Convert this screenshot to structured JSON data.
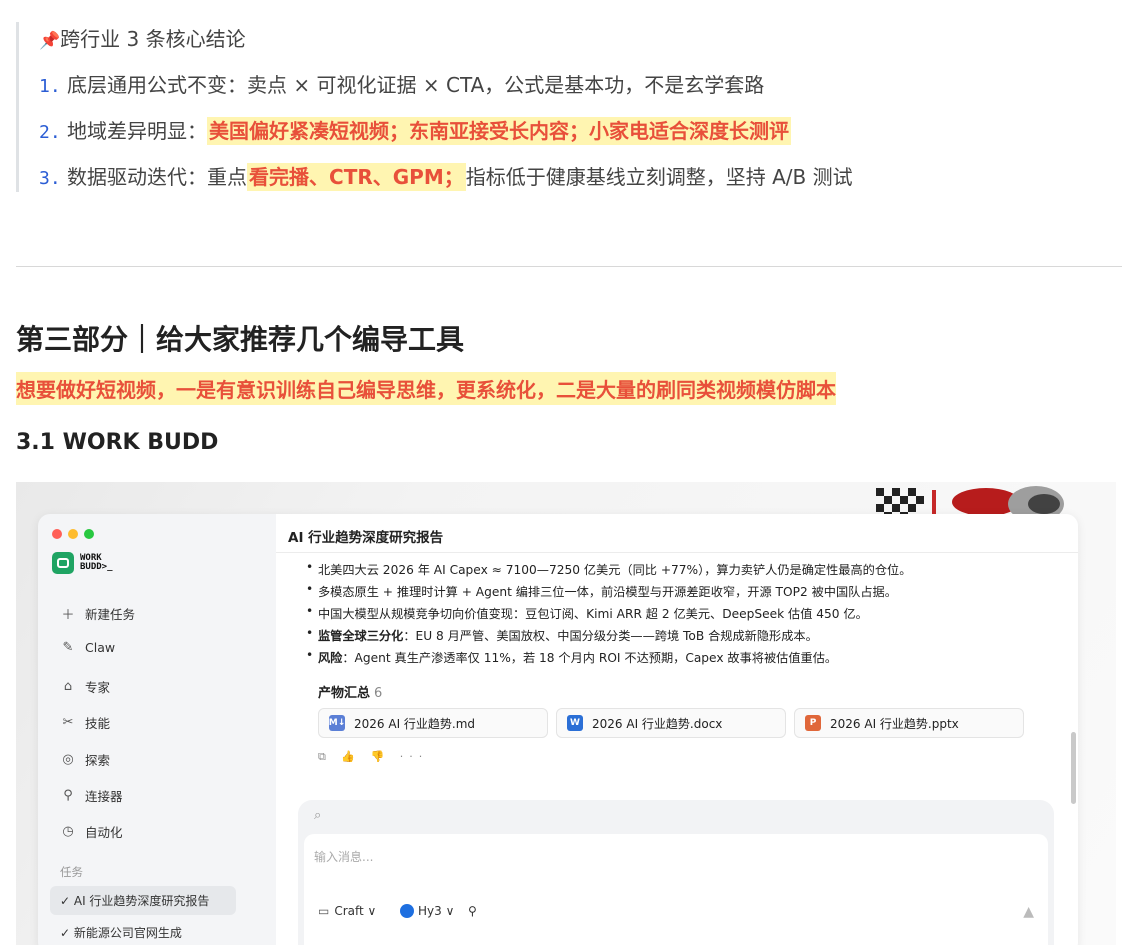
{
  "article": {
    "quote": {
      "pin_icon": "pushpin-icon",
      "title": "跨行业 3 条核心结论",
      "items": [
        {
          "num": "1.",
          "text": "底层通用公式不变：卖点 × 可视化证据 × CTA，公式是基本功，不是玄学套路"
        },
        {
          "num": "2.",
          "prefix": "地域差异明显：",
          "highlight": "美国偏好紧凑短视频；东南亚接受长内容；小家电适合深度长测评"
        },
        {
          "num": "3.",
          "prefix": "数据驱动迭代：重点",
          "highlight": "看完播、CTR、GPM；",
          "suffix": "指标低于健康基线立刻调整，坚持 A/B 测试"
        }
      ]
    },
    "section_title": "第三部分｜给大家推荐几个编导工具",
    "lead": "想要做好短视频，一是有意识训练自己编导思维，更系统化，二是大量的刷同类视频模仿脚本",
    "subheading": "3.1 WORK BUDD"
  },
  "app": {
    "logo_text_1": "WORK",
    "logo_text_2": "BUDD>_",
    "sidebar": {
      "items": [
        {
          "icon": "plus-icon",
          "glyph": "＋",
          "label": "新建任务"
        },
        {
          "icon": "claw-icon",
          "glyph": "✎",
          "label": "Claw"
        },
        {
          "icon": "graduation-cap-icon",
          "glyph": "⌂",
          "label": "专家"
        },
        {
          "icon": "tools-icon",
          "glyph": "✂",
          "label": "技能"
        },
        {
          "icon": "compass-icon",
          "glyph": "◎",
          "label": "探索"
        },
        {
          "icon": "connector-icon",
          "glyph": "⚲",
          "label": "连接器"
        },
        {
          "icon": "clock-icon",
          "glyph": "◷",
          "label": "自动化"
        }
      ],
      "group_label": "任务",
      "tasks": [
        {
          "label": "✓ AI 行业趋势深度研究报告",
          "active": true
        },
        {
          "label": "✓ 新能源公司官网生成",
          "active": false
        }
      ]
    },
    "main": {
      "title": "AI 行业趋势深度研究报告",
      "bullets": [
        {
          "bold": "",
          "text": "北美四大云 2026 年 AI Capex ≈ 7100—7250 亿美元（同比 +77%），算力卖铲人仍是确定性最高的仓位。"
        },
        {
          "bold": "",
          "text": "多模态原生 + 推理时计算 + Agent 编排三位一体，前沿模型与开源差距收窄，开源 TOP2 被中国队占据。"
        },
        {
          "bold": "",
          "text": "中国大模型从规模竞争切向价值变现：豆包订阅、Kimi ARR 超 2 亿美元、DeepSeek 估值 450 亿。"
        },
        {
          "bold": "监管全球三分化",
          "text": "：EU 8 月严管、美国放权、中国分级分类——跨境 ToB 合规成新隐形成本。"
        },
        {
          "bold": "风险",
          "text": "：Agent 真生产渗透率仅 11%，若 18 个月内 ROI 不达预期，Capex 故事将被估值重估。"
        }
      ],
      "artifacts_label": "产物汇总",
      "artifacts_count": "6",
      "files": [
        {
          "name": "2026 AI 行业趋势.md",
          "badge": "M↓",
          "color": "#5b7fd6"
        },
        {
          "name": "2026 AI 行业趋势.docx",
          "badge": "W",
          "color": "#2b6fd6"
        },
        {
          "name": "2026 AI 行业趋势.pptx",
          "badge": "P",
          "color": "#e0673a"
        }
      ],
      "action_icons": "⧉ 👍 👎 ···"
    },
    "composer": {
      "attach_icon": "paperclip-icon",
      "placeholder": "输入消息...",
      "mode_label": "Craft ∨",
      "model_label": "Hy3 ∨",
      "tools_icon": "connector-icon",
      "send_icon": "send-icon"
    }
  }
}
